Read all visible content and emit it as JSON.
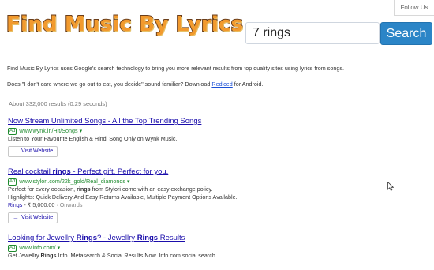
{
  "header": {
    "follow_label": "Follow Us",
    "logo_text": "Find Music By Lyrics"
  },
  "search": {
    "query": "7 rings",
    "button_label": "Search"
  },
  "intro": {
    "line1": "Find Music By Lyrics uses Google's search technology to bring you more relevant results from top quality sites using lyrics from songs.",
    "line2_prefix": "Does \"I don't care where we go out to eat, you decide\" sound familiar? Download ",
    "line2_link": "Rediced",
    "line2_suffix": " for Android."
  },
  "stats": "About 332,000 results (0.29 seconds)",
  "ad_badge": "Ad",
  "visit_label": "Visit Website",
  "results": [
    {
      "title_parts": [
        "Now Stream Unlimited Songs - All the Top Trending Songs"
      ],
      "url": "www.wynk.in/Hit/Songs ▾",
      "desc1": "Listen to Your Favourite English & Hindi Song Only on Wynk Music."
    },
    {
      "title_a": "Real cocktail ",
      "title_b": "rings",
      "title_c": " - Perfect gift. Perfect for you.",
      "url": "www.stylori.com/22k_gold/Real_diamonds ▾",
      "desc1_a": "Perfect for every occasion, ",
      "desc1_b": "rings",
      "desc1_c": " from Stylori come with an easy exchange policy.",
      "desc2": "Highlights: Quick Delivery And Easy Returns Available, Multiple Payment Options Available.",
      "price_a": "Rings",
      "price_b": " - ₹ 5,000.00",
      "price_c": " · Onwards"
    },
    {
      "title_a": "Looking for Jewellry ",
      "title_b": "Rings",
      "title_c": "? - Jewellry ",
      "title_d": "Rings",
      "title_e": " Results",
      "url": "www.info.com/ ▾",
      "desc1_a": "Get Jewellry ",
      "desc1_b": "Rings",
      "desc1_c": " Info. Metasearch & Social Results Now. Info.com social search."
    }
  ]
}
